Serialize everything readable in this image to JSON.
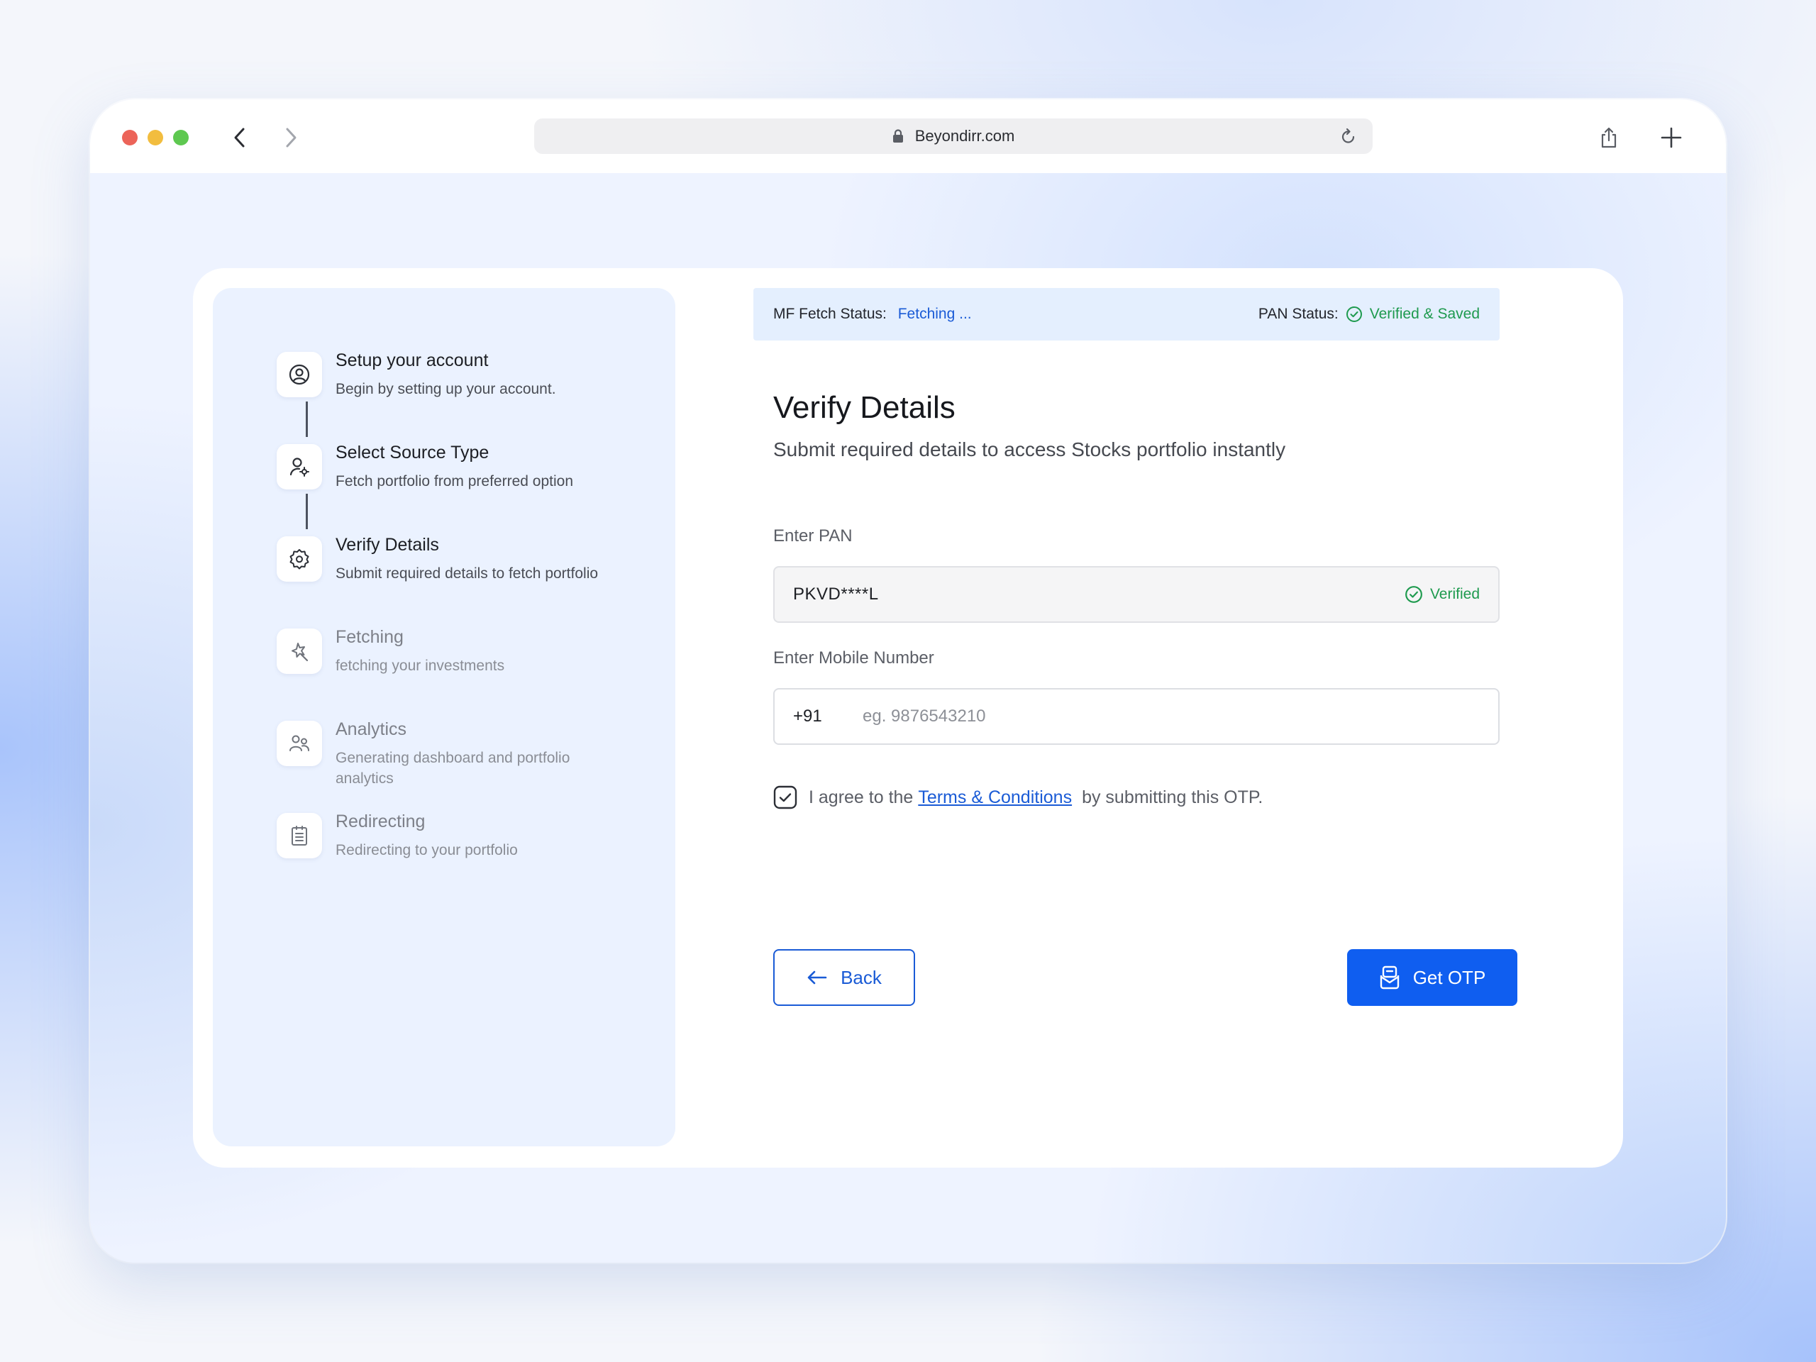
{
  "browser": {
    "url": "Beyondirr.com"
  },
  "steps": [
    {
      "title": "Setup your account",
      "desc": "Begin by setting up your account.",
      "icon": "user-circle-icon",
      "state": "done"
    },
    {
      "title": "Select Source Type",
      "desc": "Fetch portfolio from preferred option",
      "icon": "user-settings-icon",
      "state": "done"
    },
    {
      "title": "Verify Details",
      "desc": "Submit required details to fetch portfolio",
      "icon": "gear-icon",
      "state": "active"
    },
    {
      "title": "Fetching",
      "desc": "fetching your investments",
      "icon": "magic-wand-icon",
      "state": "pending"
    },
    {
      "title": "Analytics",
      "desc": "Generating dashboard and portfolio analytics",
      "icon": "users-icon",
      "state": "pending"
    },
    {
      "title": "Redirecting",
      "desc": "Redirecting to your portfolio",
      "icon": "clipboard-icon",
      "state": "pending"
    }
  ],
  "status": {
    "mf_label": "MF Fetch Status:",
    "mf_value": "Fetching ...",
    "pan_label": "PAN Status:",
    "pan_value": "Verified & Saved"
  },
  "form": {
    "title": "Verify Details",
    "subtitle": "Submit required details to access Stocks portfolio instantly",
    "pan_label": "Enter PAN",
    "pan_value": "PKVD****L",
    "pan_badge": "Verified",
    "mobile_label": "Enter Mobile Number",
    "country_code": "+91",
    "mobile_placeholder": "eg. 9876543210",
    "mobile_value": "",
    "agree_prefix": "I agree to the",
    "terms_link": "Terms & Conditions",
    "agree_suffix": "by submitting this OTP.",
    "agree_checked": true,
    "back_label": "Back",
    "otp_label": "Get OTP"
  },
  "colors": {
    "accent": "#0f5ef0",
    "link": "#1a5bd6",
    "success": "#1e9a4e",
    "panel_bg": "#ebf2ff"
  }
}
